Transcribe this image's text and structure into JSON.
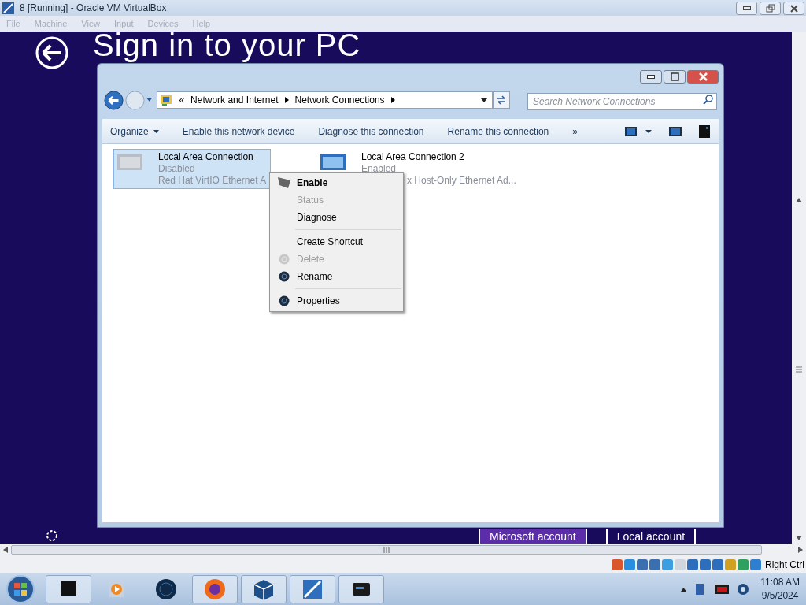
{
  "vm_window": {
    "title": "8 [Running] - Oracle VM VirtualBox",
    "menu": [
      {
        "label": "File",
        "disabled": true
      },
      {
        "label": "Machine",
        "disabled": true
      },
      {
        "label": "View",
        "disabled": true
      },
      {
        "label": "Input",
        "disabled": true
      },
      {
        "label": "Devices",
        "disabled": true
      },
      {
        "label": "Help",
        "disabled": true
      }
    ]
  },
  "guest": {
    "heading": "Sign in to your PC",
    "account_tabs": [
      {
        "label": "Microsoft account",
        "selected": true
      },
      {
        "label": "Local account",
        "selected": false
      }
    ]
  },
  "explorer": {
    "breadcrumb_prefix": "«",
    "breadcrumbs": [
      "Network and Internet",
      "Network Connections"
    ],
    "search": {
      "placeholder": "Search Network Connections"
    },
    "commands": [
      {
        "label": "Organize",
        "dropdown": true
      },
      {
        "label": "Enable this network device",
        "dropdown": false
      },
      {
        "label": "Diagnose this connection",
        "dropdown": false
      },
      {
        "label": "Rename this connection",
        "dropdown": false
      },
      {
        "label": "»",
        "dropdown": false
      }
    ],
    "connections": [
      {
        "name": "Local Area Connection",
        "status": "Disabled",
        "device": "Red Hat VirtIO Ethernet A",
        "selected": true,
        "disabled": true
      },
      {
        "name": "Local Area Connection 2",
        "status": "Enabled",
        "device": "x Host-Only Ethernet Ad...",
        "selected": false,
        "disabled": false
      }
    ]
  },
  "context_menu": {
    "items": [
      {
        "kind": "connection_item",
        "label": "Enable",
        "default": true,
        "disabled": false
      },
      {
        "kind": "item",
        "label": "Status",
        "default": false,
        "disabled": true
      },
      {
        "kind": "item",
        "label": "Diagnose",
        "default": false,
        "disabled": false
      },
      {
        "kind": "separator"
      },
      {
        "kind": "item",
        "label": "Create Shortcut",
        "default": false,
        "disabled": false
      },
      {
        "kind": "globe_item",
        "label": "Delete",
        "default": false,
        "disabled": true
      },
      {
        "kind": "globe_item",
        "label": "Rename",
        "default": false,
        "disabled": false
      },
      {
        "kind": "separator"
      },
      {
        "kind": "globe_item",
        "label": "Properties",
        "default": false,
        "disabled": false
      }
    ]
  },
  "status_bar": {
    "host_key": "Right Ctrl"
  },
  "taskbar": {
    "time": "11:08 AM",
    "date": "9/5/2024"
  }
}
